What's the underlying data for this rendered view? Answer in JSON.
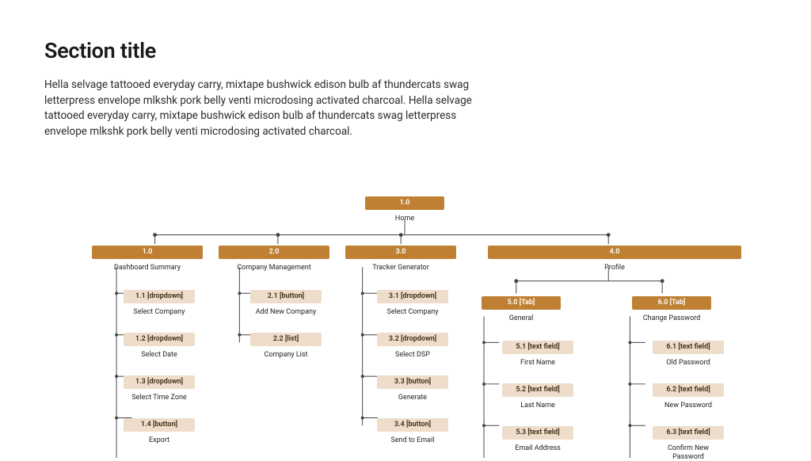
{
  "title": "Section title",
  "description": "Hella selvage tattooed everyday carry, mixtape bushwick edison bulb af thundercats swag letterpress envelope mlkshk pork belly venti microdosing activated charcoal. Hella selvage tattooed everyday carry, mixtape bushwick edison bulb af thundercats swag letterpress envelope mlkshk pork belly venti microdosing activated charcoal.",
  "root": {
    "id": "1.0",
    "label": "Home"
  },
  "sections": [
    {
      "id": "1.0",
      "label": "Dashboard Summary"
    },
    {
      "id": "2.0",
      "label": "Company Management"
    },
    {
      "id": "3.0",
      "label": "Tracker Generator"
    },
    {
      "id": "4.0",
      "label": "Profile"
    }
  ],
  "sec1_children": [
    {
      "id": "1.1 [dropdown]",
      "label": "Select Company"
    },
    {
      "id": "1.2 [dropdown]",
      "label": "Select Date"
    },
    {
      "id": "1.3 [dropdown]",
      "label": "Select Time Zone"
    },
    {
      "id": "1.4 [button]",
      "label": "Export"
    }
  ],
  "sec2_children": [
    {
      "id": "2.1 [button]",
      "label": "Add New Company"
    },
    {
      "id": "2.2 [list]",
      "label": "Company List"
    }
  ],
  "sec3_children": [
    {
      "id": "3.1 [dropdown]",
      "label": "Select Company"
    },
    {
      "id": "3.2 [dropdown]",
      "label": "Select DSP"
    },
    {
      "id": "3.3 [button]",
      "label": "Generate"
    },
    {
      "id": "3.4 [button]",
      "label": "Send to Email"
    }
  ],
  "sec4_tabs": [
    {
      "id": "5.0 [Tab]",
      "label": "General"
    },
    {
      "id": "6.0 [Tab]",
      "label": "Change Password"
    }
  ],
  "tab5_children": [
    {
      "id": "5.1 [text field]",
      "label": "First Name"
    },
    {
      "id": "5.2 [text field]",
      "label": "Last Name"
    },
    {
      "id": "5.3 [text field]",
      "label": "Email Address"
    }
  ],
  "tab6_children": [
    {
      "id": "6.1 [text field]",
      "label": "Old Password"
    },
    {
      "id": "6.2 [text field]",
      "label": "New Password"
    },
    {
      "id": "6.3 [text field]",
      "label": "Confirm New Password"
    }
  ],
  "chart_data": {
    "type": "tree",
    "title": "Sitemap / Navigation hierarchy",
    "root": {
      "id": "1.0",
      "label": "Home",
      "children": [
        {
          "id": "1.0",
          "label": "Dashboard Summary",
          "children": [
            {
              "id": "1.1",
              "type": "dropdown",
              "label": "Select Company"
            },
            {
              "id": "1.2",
              "type": "dropdown",
              "label": "Select Date"
            },
            {
              "id": "1.3",
              "type": "dropdown",
              "label": "Select Time Zone"
            },
            {
              "id": "1.4",
              "type": "button",
              "label": "Export"
            }
          ]
        },
        {
          "id": "2.0",
          "label": "Company Management",
          "children": [
            {
              "id": "2.1",
              "type": "button",
              "label": "Add New Company"
            },
            {
              "id": "2.2",
              "type": "list",
              "label": "Company List"
            }
          ]
        },
        {
          "id": "3.0",
          "label": "Tracker Generator",
          "children": [
            {
              "id": "3.1",
              "type": "dropdown",
              "label": "Select Company"
            },
            {
              "id": "3.2",
              "type": "dropdown",
              "label": "Select DSP"
            },
            {
              "id": "3.3",
              "type": "button",
              "label": "Generate"
            },
            {
              "id": "3.4",
              "type": "button",
              "label": "Send to Email"
            }
          ]
        },
        {
          "id": "4.0",
          "label": "Profile",
          "children": [
            {
              "id": "5.0",
              "type": "Tab",
              "label": "General",
              "children": [
                {
                  "id": "5.1",
                  "type": "text field",
                  "label": "First Name"
                },
                {
                  "id": "5.2",
                  "type": "text field",
                  "label": "Last Name"
                },
                {
                  "id": "5.3",
                  "type": "text field",
                  "label": "Email Address"
                }
              ]
            },
            {
              "id": "6.0",
              "type": "Tab",
              "label": "Change Password",
              "children": [
                {
                  "id": "6.1",
                  "type": "text field",
                  "label": "Old Password"
                },
                {
                  "id": "6.2",
                  "type": "text field",
                  "label": "New Password"
                },
                {
                  "id": "6.3",
                  "type": "text field",
                  "label": "Confirm New Password"
                }
              ]
            }
          ]
        }
      ]
    }
  }
}
